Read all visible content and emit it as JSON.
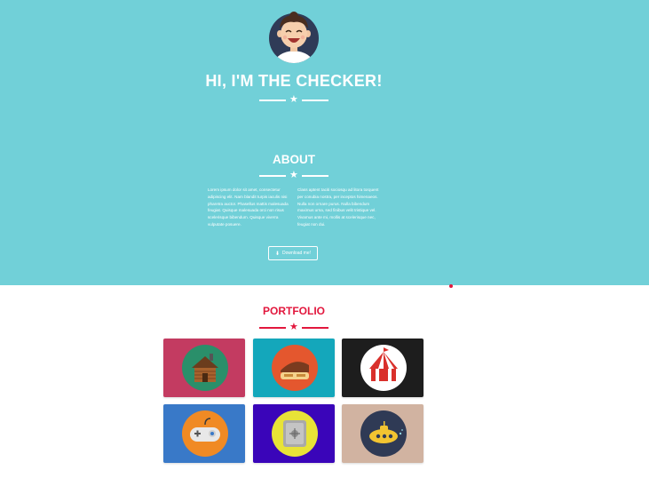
{
  "colors": {
    "hero_bg": "#71d0d8",
    "accent": "#e2173d",
    "white": "#ffffff"
  },
  "hero": {
    "title": "HI, I'M THE CHECKER!",
    "avatar_icon": "avatar-illustration"
  },
  "about": {
    "title": "ABOUT",
    "col_left": "Lorem ipsum dolor sit amet, consectetur adipiscing elit. Nam blandit turpis iaculis nisi pharetra auctor. Phasellus mattis malesuada feugiat. Quisque malesuada orci non risus scelerisque bibendum. Quisque viverra vulputate posuere.",
    "col_right": "Class aptent taciti sociosqu ad litora torquent per conubia nostra, per inceptos himenaeos. Nulla non ornare purus. Nulla bibendum maximus urna, sed finibus velit tristique vel. Vivamus ante mi, mollis at scelerisque nec, feugiat non dui.",
    "download_label": "Download me!",
    "download_icon": "download-icon"
  },
  "portfolio": {
    "title": "PORTFOLIO",
    "items": [
      {
        "name": "cabin",
        "icon": "cabin-icon",
        "bg": "#c33b61"
      },
      {
        "name": "cake",
        "icon": "cake-icon",
        "bg": "#14a7bb"
      },
      {
        "name": "circus",
        "icon": "circus-tent-icon",
        "bg": "#1d1d1d"
      },
      {
        "name": "game",
        "icon": "game-controller-icon",
        "bg": "#3979c8"
      },
      {
        "name": "safe",
        "icon": "safe-icon",
        "bg": "#3a05b9"
      },
      {
        "name": "submarine",
        "icon": "submarine-icon",
        "bg": "#d1b3a1"
      }
    ]
  }
}
